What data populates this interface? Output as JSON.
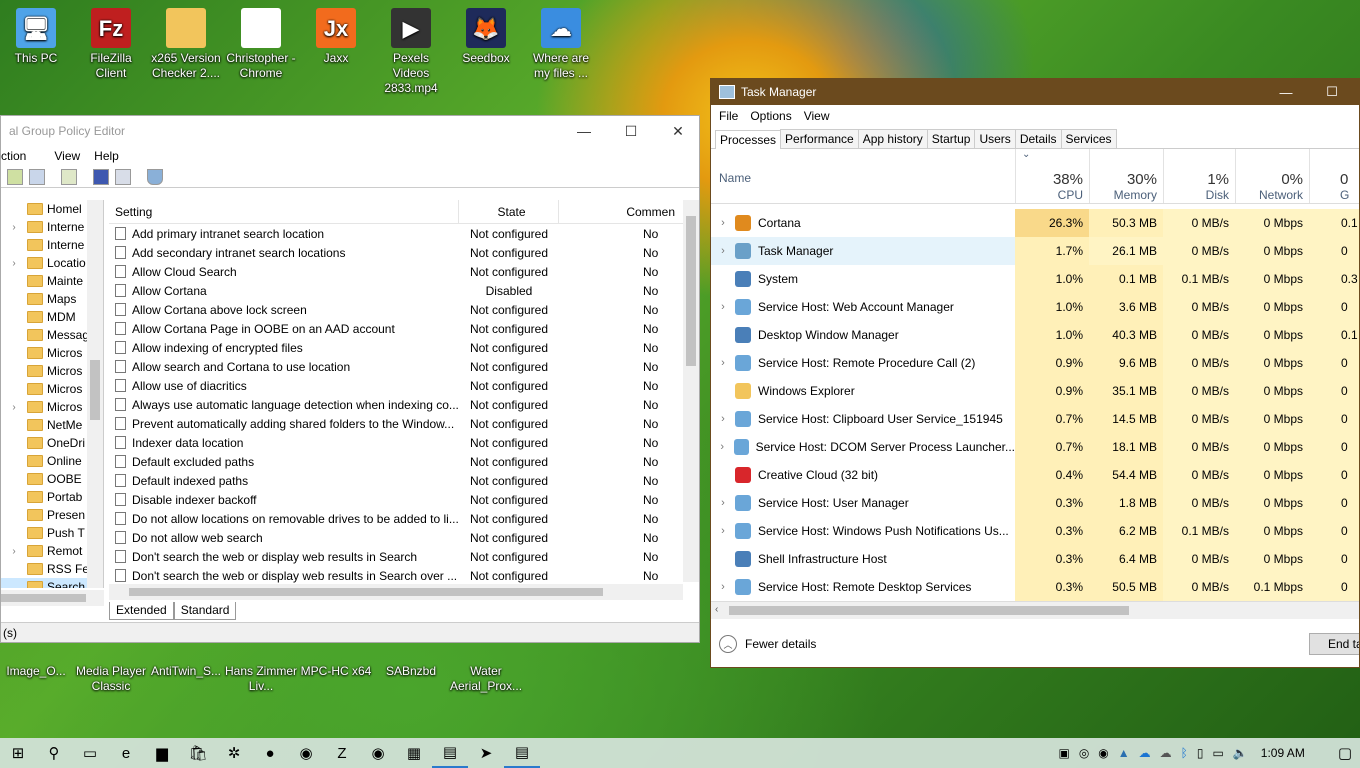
{
  "desktop_top": [
    {
      "label": "This PC",
      "icon": "computer-icon",
      "color": "#4ea3e8",
      "glyph": "🖥"
    },
    {
      "label": "FileZilla Client",
      "icon": "filezilla-icon",
      "color": "#bf1f1f",
      "glyph": "Fz"
    },
    {
      "label": "x265 Version Checker 2....",
      "icon": "folder-icon",
      "color": "#f2c55c",
      "glyph": ""
    },
    {
      "label": "Christopher - Chrome",
      "icon": "document-icon",
      "color": "#ffffff",
      "glyph": ""
    },
    {
      "label": "Jaxx",
      "icon": "jaxx-icon",
      "color": "#f26b1d",
      "glyph": "Jx"
    },
    {
      "label": "Pexels Videos 2833.mp4",
      "icon": "video-file-icon",
      "color": "#333333",
      "glyph": "▶"
    },
    {
      "label": "Seedbox",
      "icon": "firefox-icon",
      "color": "#1e2a5a",
      "glyph": "🦊"
    },
    {
      "label": "Where are my files ...",
      "icon": "onedrive-icon",
      "color": "#3a8de0",
      "glyph": "☁"
    }
  ],
  "desktop_bottom": [
    {
      "label": "Image_O...",
      "icon": "image-icon"
    },
    {
      "label": "Media Player Classic",
      "icon": "media-player-icon"
    },
    {
      "label": "AntiTwin_S...",
      "icon": "antitwin-icon"
    },
    {
      "label": "Hans Zimmer Liv...",
      "icon": "document-icon"
    },
    {
      "label": "MPC-HC x64",
      "icon": "mpc-hc-icon"
    },
    {
      "label": "SABnzbd",
      "icon": "sabnzbd-icon"
    },
    {
      "label": "Water Aerial_Prox...",
      "icon": "vlc-icon"
    }
  ],
  "gpedit": {
    "title": "al Group Policy Editor",
    "menu": [
      "ction",
      "View",
      "Help"
    ],
    "tree": [
      {
        "label": "Homel",
        "exp": ""
      },
      {
        "label": "Interne",
        "exp": "›"
      },
      {
        "label": "Interne",
        "exp": ""
      },
      {
        "label": "Locatio",
        "exp": "›"
      },
      {
        "label": "Mainte",
        "exp": ""
      },
      {
        "label": "Maps",
        "exp": ""
      },
      {
        "label": "MDM",
        "exp": ""
      },
      {
        "label": "Messag",
        "exp": ""
      },
      {
        "label": "Micros",
        "exp": ""
      },
      {
        "label": "Micros",
        "exp": ""
      },
      {
        "label": "Micros",
        "exp": ""
      },
      {
        "label": "Micros",
        "exp": "›"
      },
      {
        "label": "NetMe",
        "exp": ""
      },
      {
        "label": "OneDri",
        "exp": ""
      },
      {
        "label": "Online",
        "exp": ""
      },
      {
        "label": "OOBE",
        "exp": ""
      },
      {
        "label": "Portab",
        "exp": ""
      },
      {
        "label": "Presen",
        "exp": ""
      },
      {
        "label": "Push T",
        "exp": ""
      },
      {
        "label": "Remot",
        "exp": "›"
      },
      {
        "label": "RSS Fe",
        "exp": ""
      },
      {
        "label": "Search",
        "exp": ""
      }
    ],
    "columns": {
      "setting": "Setting",
      "state": "State",
      "comment": "Commen"
    },
    "rows": [
      {
        "s": "Add primary intranet search location",
        "st": "Not configured",
        "c": "No"
      },
      {
        "s": "Add secondary intranet search locations",
        "st": "Not configured",
        "c": "No"
      },
      {
        "s": "Allow Cloud Search",
        "st": "Not configured",
        "c": "No"
      },
      {
        "s": "Allow Cortana",
        "st": "Disabled",
        "c": "No"
      },
      {
        "s": "Allow Cortana above lock screen",
        "st": "Not configured",
        "c": "No"
      },
      {
        "s": "Allow Cortana Page in OOBE on an AAD account",
        "st": "Not configured",
        "c": "No"
      },
      {
        "s": "Allow indexing of encrypted files",
        "st": "Not configured",
        "c": "No"
      },
      {
        "s": "Allow search and Cortana to use location",
        "st": "Not configured",
        "c": "No"
      },
      {
        "s": "Allow use of diacritics",
        "st": "Not configured",
        "c": "No"
      },
      {
        "s": "Always use automatic language detection when indexing co...",
        "st": "Not configured",
        "c": "No"
      },
      {
        "s": "Prevent automatically adding shared folders to the Window...",
        "st": "Not configured",
        "c": "No"
      },
      {
        "s": "Indexer data location",
        "st": "Not configured",
        "c": "No"
      },
      {
        "s": "Default excluded paths",
        "st": "Not configured",
        "c": "No"
      },
      {
        "s": "Default indexed paths",
        "st": "Not configured",
        "c": "No"
      },
      {
        "s": "Disable indexer backoff",
        "st": "Not configured",
        "c": "No"
      },
      {
        "s": "Do not allow locations on removable drives to be added to li...",
        "st": "Not configured",
        "c": "No"
      },
      {
        "s": "Do not allow web search",
        "st": "Not configured",
        "c": "No"
      },
      {
        "s": "Don't search the web or display web results in Search",
        "st": "Not configured",
        "c": "No"
      },
      {
        "s": "Don't search the web or display web results in Search over ...",
        "st": "Not configured",
        "c": "No"
      }
    ],
    "tabs": [
      "Extended",
      "Standard"
    ],
    "status": "(s)"
  },
  "taskmgr": {
    "title": "Task Manager",
    "menu": [
      "File",
      "Options",
      "View"
    ],
    "tabs": [
      "Processes",
      "Performance",
      "App history",
      "Startup",
      "Users",
      "Details",
      "Services"
    ],
    "headers": [
      {
        "pct": "",
        "label": "Name"
      },
      {
        "pct": "38%",
        "label": "CPU"
      },
      {
        "pct": "30%",
        "label": "Memory"
      },
      {
        "pct": "1%",
        "label": "Disk"
      },
      {
        "pct": "0%",
        "label": "Network"
      },
      {
        "pct": "0",
        "label": "G"
      }
    ],
    "rows": [
      {
        "name": "Cortana",
        "exp": "›",
        "icon": "cortana-icon",
        "ic": "#e08a1e",
        "cpu": "26.3%",
        "mem": "50.3 MB",
        "disk": "0 MB/s",
        "net": "0 Mbps",
        "g": "0.1"
      },
      {
        "name": "Task Manager",
        "exp": "›",
        "icon": "task-manager-icon",
        "ic": "#6aa0c8",
        "cpu": "1.7%",
        "mem": "26.1 MB",
        "disk": "0 MB/s",
        "net": "0 Mbps",
        "g": "0"
      },
      {
        "name": "System",
        "exp": "",
        "icon": "system-icon",
        "ic": "#4a7fb8",
        "cpu": "1.0%",
        "mem": "0.1 MB",
        "disk": "0.1 MB/s",
        "net": "0 Mbps",
        "g": "0.3"
      },
      {
        "name": "Service Host: Web Account Manager",
        "exp": "›",
        "icon": "gear-icon",
        "ic": "#6aa6d8",
        "cpu": "1.0%",
        "mem": "3.6 MB",
        "disk": "0 MB/s",
        "net": "0 Mbps",
        "g": "0"
      },
      {
        "name": "Desktop Window Manager",
        "exp": "",
        "icon": "dwm-icon",
        "ic": "#4a7fb8",
        "cpu": "1.0%",
        "mem": "40.3 MB",
        "disk": "0 MB/s",
        "net": "0 Mbps",
        "g": "0.1"
      },
      {
        "name": "Service Host: Remote Procedure Call (2)",
        "exp": "›",
        "icon": "gear-icon",
        "ic": "#6aa6d8",
        "cpu": "0.9%",
        "mem": "9.6 MB",
        "disk": "0 MB/s",
        "net": "0 Mbps",
        "g": "0"
      },
      {
        "name": "Windows Explorer",
        "exp": "",
        "icon": "folder-icon",
        "ic": "#f2c55c",
        "cpu": "0.9%",
        "mem": "35.1 MB",
        "disk": "0 MB/s",
        "net": "0 Mbps",
        "g": "0"
      },
      {
        "name": "Service Host: Clipboard User Service_151945",
        "exp": "›",
        "icon": "gear-icon",
        "ic": "#6aa6d8",
        "cpu": "0.7%",
        "mem": "14.5 MB",
        "disk": "0 MB/s",
        "net": "0 Mbps",
        "g": "0"
      },
      {
        "name": "Service Host: DCOM Server Process Launcher...",
        "exp": "›",
        "icon": "gear-icon",
        "ic": "#6aa6d8",
        "cpu": "0.7%",
        "mem": "18.1 MB",
        "disk": "0 MB/s",
        "net": "0 Mbps",
        "g": "0"
      },
      {
        "name": "Creative Cloud (32 bit)",
        "exp": "",
        "icon": "creative-cloud-icon",
        "ic": "#d8262b",
        "cpu": "0.4%",
        "mem": "54.4 MB",
        "disk": "0 MB/s",
        "net": "0 Mbps",
        "g": "0"
      },
      {
        "name": "Service Host: User Manager",
        "exp": "›",
        "icon": "gear-icon",
        "ic": "#6aa6d8",
        "cpu": "0.3%",
        "mem": "1.8 MB",
        "disk": "0 MB/s",
        "net": "0 Mbps",
        "g": "0"
      },
      {
        "name": "Service Host: Windows Push Notifications Us...",
        "exp": "›",
        "icon": "gear-icon",
        "ic": "#6aa6d8",
        "cpu": "0.3%",
        "mem": "6.2 MB",
        "disk": "0.1 MB/s",
        "net": "0 Mbps",
        "g": "0"
      },
      {
        "name": "Shell Infrastructure Host",
        "exp": "",
        "icon": "shell-host-icon",
        "ic": "#4a7fb8",
        "cpu": "0.3%",
        "mem": "6.4 MB",
        "disk": "0 MB/s",
        "net": "0 Mbps",
        "g": "0"
      },
      {
        "name": "Service Host: Remote Desktop Services",
        "exp": "›",
        "icon": "gear-icon",
        "ic": "#6aa6d8",
        "cpu": "0.3%",
        "mem": "50.5 MB",
        "disk": "0 MB/s",
        "net": "0.1 Mbps",
        "g": "0"
      }
    ],
    "fewer_details": "Fewer details",
    "end_task": "End ta"
  },
  "taskbar": {
    "items": [
      {
        "name": "start-button",
        "glyph": "⊞"
      },
      {
        "name": "search-button",
        "glyph": "⚲"
      },
      {
        "name": "task-view-button",
        "glyph": "▭"
      },
      {
        "name": "edge-icon",
        "glyph": "e"
      },
      {
        "name": "file-explorer-icon",
        "glyph": "▆"
      },
      {
        "name": "store-icon",
        "glyph": "🛍"
      },
      {
        "name": "network-tool-icon",
        "glyph": "✲"
      },
      {
        "name": "firefox-icon",
        "glyph": "●"
      },
      {
        "name": "chrome-icon",
        "glyph": "◉"
      },
      {
        "name": "filezilla-icon",
        "glyph": "Z"
      },
      {
        "name": "chrome-alt-icon",
        "glyph": "◉"
      },
      {
        "name": "media-icon",
        "glyph": "▦"
      },
      {
        "name": "task-manager-taskbar-icon",
        "glyph": "▤"
      },
      {
        "name": "send-icon",
        "glyph": "➤"
      },
      {
        "name": "notepad-icon",
        "glyph": "▤"
      }
    ],
    "time": "1:09 AM"
  }
}
